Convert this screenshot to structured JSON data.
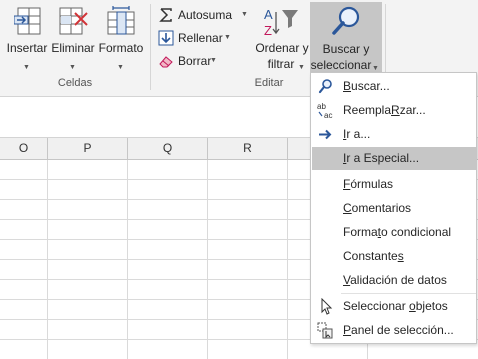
{
  "ribbon": {
    "celdas": {
      "insertar_label": "Insertar",
      "eliminar_label": "Eliminar",
      "formato_label": "Formato",
      "group_label": "Celdas"
    },
    "editar": {
      "autosuma_label": "Autosuma",
      "rellenar_label": "Rellenar",
      "borrar_label": "Borrar",
      "ordenar_label_1": "Ordenar y",
      "ordenar_label_2": "filtrar",
      "buscar_label_1": "Buscar y",
      "buscar_label_2": "seleccionar",
      "group_label": "Editar"
    }
  },
  "columns": [
    "O",
    "P",
    "Q",
    "R"
  ],
  "menu": {
    "items": [
      {
        "label": "Buscar...",
        "ul": "B",
        "pre": "",
        "post": "uscar...",
        "icon": "search-icon"
      },
      {
        "label": "Reemplazar...",
        "ul": "R",
        "pre": "Reempla",
        "post": "zar...",
        "icon": "replace-icon"
      },
      {
        "label": "Ir a...",
        "ul": "I",
        "pre": "",
        "post": "r a...",
        "icon": "goto-arrow-icon"
      },
      {
        "label": "Ir a Especial...",
        "ul": "I",
        "pre": "",
        "post": "r a Especial...",
        "icon": ""
      },
      {
        "label": "Fórmulas",
        "ul": "F",
        "pre": "",
        "post": "órmulas",
        "icon": ""
      },
      {
        "label": "Comentarios",
        "ul": "C",
        "pre": "",
        "post": "omentarios",
        "icon": ""
      },
      {
        "label": "Formato condicional",
        "ul": "t",
        "pre": "Forma",
        "post": "o condicional",
        "icon": ""
      },
      {
        "label": "Constantes",
        "ul": "s",
        "pre": "Constante",
        "post": "",
        "icon": ""
      },
      {
        "label": "Validación de datos",
        "ul": "V",
        "pre": "",
        "post": "alidación de datos",
        "icon": ""
      },
      {
        "label": "Seleccionar objetos",
        "ul": "o",
        "pre": "Seleccionar ",
        "post": "bjetos",
        "icon": "select-pointer-icon"
      },
      {
        "label": "Panel de selección...",
        "ul": "P",
        "pre": "",
        "post": "anel de selección...",
        "icon": "selection-pane-icon"
      }
    ]
  },
  "colors": {
    "menu_highlight": "#c6c6c6",
    "ribbon_bg": "#f3f3f3",
    "accent_blue": "#2b579a",
    "delete_red": "#d13438"
  }
}
